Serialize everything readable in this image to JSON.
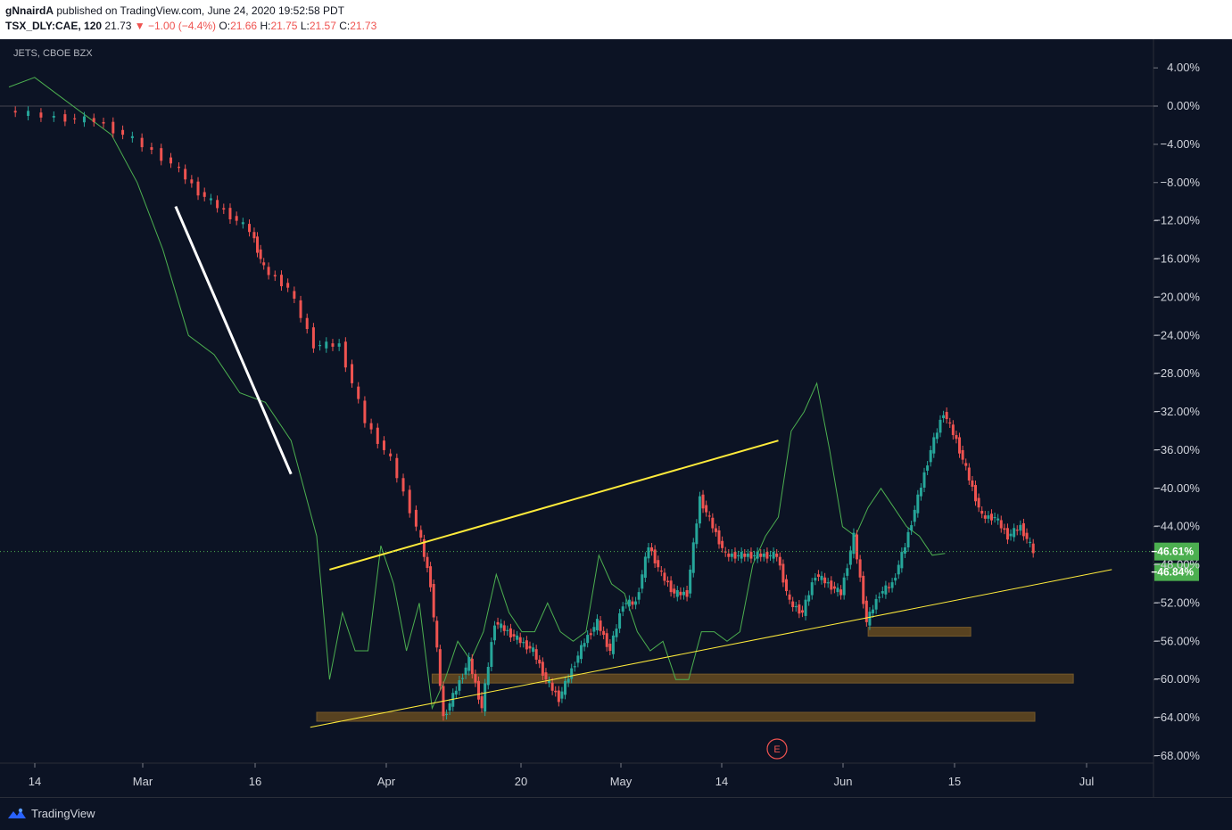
{
  "header": {
    "author": "gNnairdA",
    "published": "published on TradingView.com, June 24, 2020 19:52:58 PDT",
    "symbol": "TSX_DLY:CAE, 120",
    "last": "21.73",
    "change_arrow": "▼",
    "change": "−1.00 (−4.4%)",
    "o_label": "O:",
    "o": "21.66",
    "h_label": "H:",
    "h": "21.75",
    "l_label": "L:",
    "l": "21.57",
    "c_label": "C:",
    "c": "21.73"
  },
  "overlay": {
    "label": "JETS, CBOE BZX"
  },
  "earnings_marker": "E",
  "footer": {
    "brand": "TradingView",
    "logo_icon": "tradingview-logo-icon"
  },
  "colors": {
    "background": "#0c1324",
    "up_candle": "#26a69a",
    "down_candle": "#ef5350",
    "overlay_line": "#4caf50",
    "trendline_yellow": "#ffeb3b",
    "trendline_white": "#ffffff",
    "support_zone": "#5d4520",
    "price_badge": "#4caf50"
  },
  "chart_data": {
    "type": "line",
    "title": "TSX_DLY:CAE, 120",
    "xlabel": "",
    "ylabel": "",
    "y_scale": "percent",
    "ylim": [
      -69,
      5
    ],
    "y_ticks": [
      "4.00%",
      "0.00%",
      "−4.00%",
      "−8.00%",
      "−12.00%",
      "−16.00%",
      "−20.00%",
      "−24.00%",
      "−28.00%",
      "−32.00%",
      "−36.00%",
      "−40.00%",
      "−44.00%",
      "−48.00%",
      "−52.00%",
      "−56.00%",
      "−60.00%",
      "−64.00%",
      "−68.00%"
    ],
    "x_ticks": [
      "14",
      "Mar",
      "16",
      "Apr",
      "20",
      "May",
      "14",
      "Jun",
      "15",
      "Jul"
    ],
    "grid": false,
    "last_value_labels": [
      "−46.61%",
      "−46.84%"
    ],
    "series": [
      {
        "name": "TSX_DLY:CAE",
        "style": "candles",
        "values": [
          [
            0,
            -0.5
          ],
          [
            8,
            -1.2
          ],
          [
            14,
            -1.5
          ],
          [
            20,
            -3.5
          ],
          [
            26,
            -6
          ],
          [
            30,
            -9
          ],
          [
            34,
            -11
          ],
          [
            38,
            -13
          ],
          [
            40,
            -17
          ],
          [
            44,
            -19
          ],
          [
            48,
            -25
          ],
          [
            52,
            -25
          ],
          [
            56,
            -33
          ],
          [
            60,
            -37
          ],
          [
            64,
            -44
          ],
          [
            66,
            -50
          ],
          [
            68,
            -64
          ],
          [
            70,
            -61
          ],
          [
            72,
            -58
          ],
          [
            74,
            -63
          ],
          [
            76,
            -54
          ],
          [
            78,
            -55
          ],
          [
            80,
            -56
          ],
          [
            82,
            -57
          ],
          [
            84,
            -60
          ],
          [
            86,
            -62
          ],
          [
            88,
            -59
          ],
          [
            90,
            -56
          ],
          [
            92,
            -54
          ],
          [
            94,
            -57
          ],
          [
            96,
            -52
          ],
          [
            98,
            -52
          ],
          [
            100,
            -46
          ],
          [
            102,
            -49
          ],
          [
            104,
            -51
          ],
          [
            106,
            -51
          ],
          [
            108,
            -41
          ],
          [
            110,
            -44
          ],
          [
            112,
            -47
          ],
          [
            114,
            -47
          ],
          [
            116,
            -47
          ],
          [
            118,
            -47
          ],
          [
            120,
            -47
          ],
          [
            122,
            -52
          ],
          [
            124,
            -53
          ],
          [
            126,
            -49
          ],
          [
            128,
            -50
          ],
          [
            130,
            -51
          ],
          [
            132,
            -45
          ],
          [
            134,
            -54
          ],
          [
            136,
            -51
          ],
          [
            138,
            -50
          ],
          [
            140,
            -46
          ],
          [
            142,
            -41
          ],
          [
            144,
            -36
          ],
          [
            146,
            -32
          ],
          [
            148,
            -35
          ],
          [
            150,
            -39
          ],
          [
            152,
            -43
          ],
          [
            154,
            -43
          ],
          [
            156,
            -45
          ],
          [
            158,
            -44
          ],
          [
            160,
            -46.6
          ]
        ]
      },
      {
        "name": "JETS, CBOE BZX",
        "style": "line",
        "values": [
          [
            0,
            2
          ],
          [
            4,
            3
          ],
          [
            8,
            1
          ],
          [
            12,
            -1
          ],
          [
            16,
            -3
          ],
          [
            20,
            -8
          ],
          [
            24,
            -15
          ],
          [
            28,
            -24
          ],
          [
            32,
            -26
          ],
          [
            36,
            -30
          ],
          [
            40,
            -31
          ],
          [
            44,
            -35
          ],
          [
            48,
            -45
          ],
          [
            50,
            -60
          ],
          [
            52,
            -53
          ],
          [
            54,
            -57
          ],
          [
            56,
            -57
          ],
          [
            58,
            -46
          ],
          [
            60,
            -50
          ],
          [
            62,
            -57
          ],
          [
            64,
            -52
          ],
          [
            66,
            -63
          ],
          [
            68,
            -60
          ],
          [
            70,
            -56
          ],
          [
            72,
            -58
          ],
          [
            74,
            -55
          ],
          [
            76,
            -49
          ],
          [
            78,
            -53
          ],
          [
            80,
            -55
          ],
          [
            82,
            -55
          ],
          [
            84,
            -52
          ],
          [
            86,
            -55
          ],
          [
            88,
            -56
          ],
          [
            90,
            -55
          ],
          [
            92,
            -47
          ],
          [
            94,
            -50
          ],
          [
            96,
            -51
          ],
          [
            98,
            -55
          ],
          [
            100,
            -57
          ],
          [
            102,
            -56
          ],
          [
            104,
            -60
          ],
          [
            106,
            -60
          ],
          [
            108,
            -55
          ],
          [
            110,
            -55
          ],
          [
            112,
            -56
          ],
          [
            114,
            -55
          ],
          [
            116,
            -48
          ],
          [
            118,
            -45
          ],
          [
            120,
            -43
          ],
          [
            122,
            -34
          ],
          [
            124,
            -32
          ],
          [
            126,
            -29
          ],
          [
            128,
            -36
          ],
          [
            130,
            -44
          ],
          [
            132,
            -45
          ],
          [
            134,
            -42
          ],
          [
            136,
            -40
          ],
          [
            138,
            -42
          ],
          [
            140,
            -44
          ],
          [
            142,
            -45
          ],
          [
            144,
            -47
          ],
          [
            146,
            -46.8
          ]
        ]
      }
    ],
    "annotations": [
      {
        "type": "trendline",
        "color": "white",
        "description": "descending resistance"
      },
      {
        "type": "trendline",
        "color": "yellow",
        "description": "ascending resistance"
      },
      {
        "type": "trendline",
        "color": "yellow",
        "description": "ascending support"
      },
      {
        "type": "zone",
        "color": "brown",
        "description": "support zones (3)"
      }
    ]
  }
}
